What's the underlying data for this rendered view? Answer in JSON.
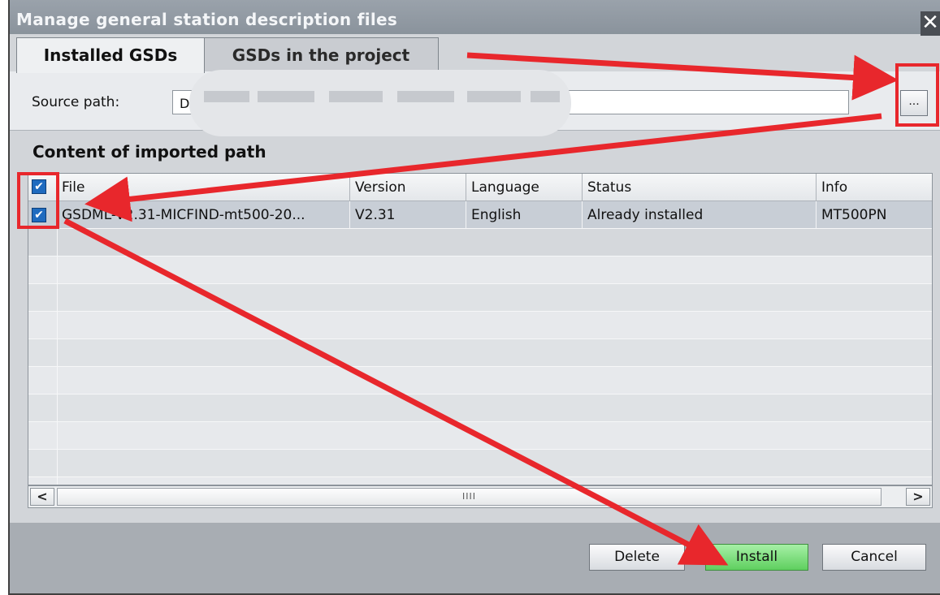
{
  "window": {
    "title": "Manage general station description files",
    "close_glyph": "✕"
  },
  "tabs": [
    {
      "label": "Installed GSDs",
      "active": true
    },
    {
      "label": "GSDs in the project",
      "active": false
    }
  ],
  "source": {
    "label": "Source path:",
    "value": "D:",
    "browse_label": "..."
  },
  "content": {
    "title": "Content of imported path"
  },
  "table": {
    "columns": [
      "File",
      "Version",
      "Language",
      "Status",
      "Info"
    ],
    "rows": [
      {
        "checked": true,
        "file": "GSDML-V2.31-MICFIND-mt500-20...",
        "version": "V2.31",
        "language": "English",
        "status": "Already installed",
        "info": "MT500PN"
      }
    ],
    "check_glyph": "✔"
  },
  "scrollbar": {
    "left_arrow": "<",
    "right_arrow": ">",
    "thumb_grip": "IIII"
  },
  "buttons": {
    "delete": "Delete",
    "install": "Install",
    "cancel": "Cancel"
  },
  "colors": {
    "annotation_red": "#e8272c",
    "install_green": "#5fcf5f",
    "checkbox_blue": "#1f6bbf"
  }
}
